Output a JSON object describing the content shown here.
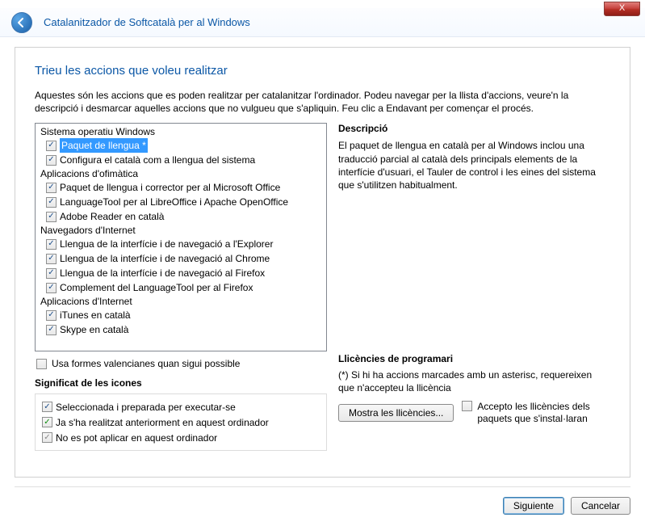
{
  "window": {
    "close_x": "X",
    "back_title": "Enrere",
    "header_title": "Catalanitzador de Softcatalà per al Windows"
  },
  "page": {
    "heading": "Trieu les accions que voleu realitzar",
    "intro": "Aquestes són les accions que es poden realitzar per catalanitzar l'ordinador. Podeu navegar per la llista d'accions, veure'n la descripció i desmarcar aquelles accions que no vulgueu que s'apliquin. Feu clic a Endavant per començar el procés."
  },
  "groups": [
    {
      "title": "Sistema operatiu Windows",
      "items": [
        {
          "label": "Paquet de llengua *",
          "selected": true
        },
        {
          "label": "Configura el català com a llengua del sistema"
        }
      ]
    },
    {
      "title": "Aplicacions d'ofimàtica",
      "items": [
        {
          "label": "Paquet de llengua i corrector per al Microsoft Office"
        },
        {
          "label": "LanguageTool per al LibreOffice i Apache OpenOffice"
        },
        {
          "label": "Adobe Reader en català"
        }
      ]
    },
    {
      "title": "Navegadors d'Internet",
      "items": [
        {
          "label": "Llengua de la interfície i de navegació a l'Explorer"
        },
        {
          "label": "Llengua de la interfície i de navegació al Chrome"
        },
        {
          "label": "Llengua de la interfície i de navegació al Firefox"
        },
        {
          "label": "Complement del LanguageTool per al Firefox"
        }
      ]
    },
    {
      "title": "Aplicacions d'Internet",
      "items": [
        {
          "label": "iTunes en català"
        },
        {
          "label": "Skype en català"
        }
      ]
    }
  ],
  "valencian": {
    "label": "Usa formes valencianes quan sigui possible"
  },
  "legend": {
    "title": "Significat de les icones",
    "items": [
      {
        "label": "Seleccionada i preparada per executar-se",
        "style": "blue"
      },
      {
        "label": "Ja s'ha realitzat anteriorment en aquest ordinador",
        "style": "green"
      },
      {
        "label": "No es pot aplicar en aquest ordinador",
        "style": "gray"
      }
    ]
  },
  "description": {
    "title": "Descripció",
    "body": "El paquet de llengua en català per al Windows inclou una traducció parcial al català dels principals elements de la interfície d'usuari, el Tauler de control i les eines del sistema que s'utilitzen habitualment."
  },
  "licenses": {
    "title": "Llicències de programari",
    "note": "(*) Si hi ha accions marcades amb un asterisc, requereixen que n'accepteu la llicència",
    "show_button": "Mostra les llicències...",
    "accept_label": "Accepto les llicències dels paquets que s'instal·laran"
  },
  "footer": {
    "next": "Siguiente",
    "cancel": "Cancelar"
  }
}
